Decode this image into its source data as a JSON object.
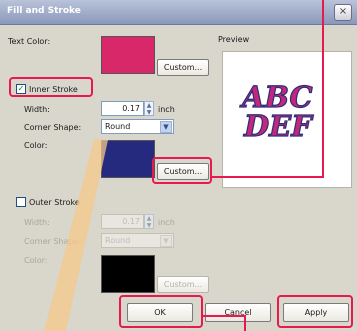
{
  "window": {
    "title": "Fill and Stroke",
    "close_glyph": "×"
  },
  "text_color": {
    "label": "Text Color:",
    "swatch_color": "#d8286a",
    "button": "Custom..."
  },
  "preview": {
    "label": "Preview",
    "line1": "ABC",
    "line2": "DEF",
    "fill_color": "#c2277d",
    "stroke_color": "#2c2e7a"
  },
  "inner_stroke": {
    "label": "Inner Stroke",
    "checked": true,
    "check_glyph": "✓",
    "width_label": "Width:",
    "width_value": "0.17",
    "width_unit": "inch",
    "corner_label": "Corner Shape:",
    "corner_value": "Round",
    "color_label": "Color:",
    "swatch_color": "#262a7e",
    "button": "Custom..."
  },
  "outer_stroke": {
    "label": "Outer Stroke",
    "checked": false,
    "width_label": "Width:",
    "width_value": "0.17",
    "width_unit": "inch",
    "corner_label": "Corner Shape:",
    "corner_value": "Round",
    "color_label": "Color:",
    "swatch_color": "#000000",
    "button": "Custom..."
  },
  "footer": {
    "ok": "OK",
    "cancel": "Cancel",
    "apply": "Apply"
  },
  "highlight_color": "#e7194f"
}
